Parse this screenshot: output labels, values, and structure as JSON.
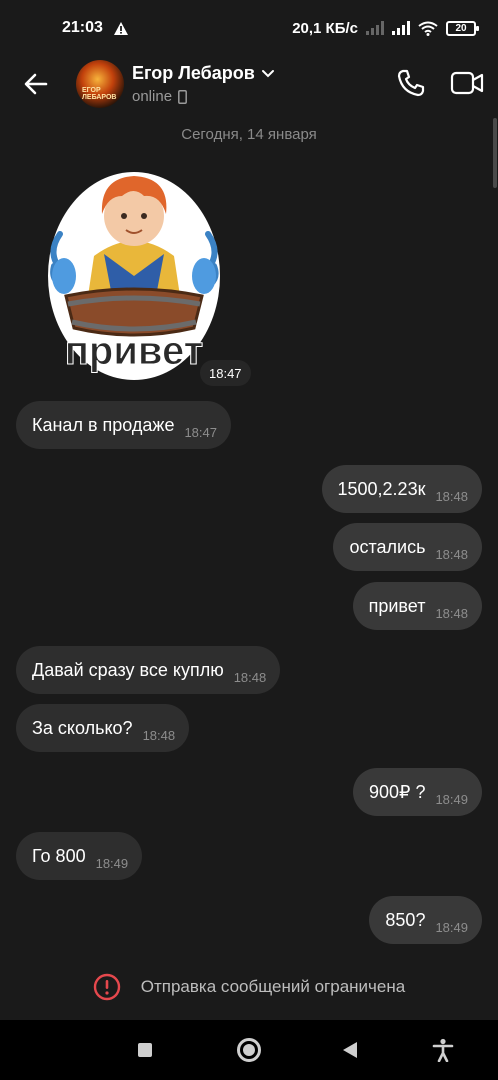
{
  "status_bar": {
    "time": "21:03",
    "network_speed": "20,1 КБ/с",
    "battery": "20",
    "icons": [
      "alert-icon",
      "signal-icon",
      "wifi-icon",
      "battery-icon"
    ]
  },
  "header": {
    "contact_name": "Егор Лебаров",
    "presence": "online",
    "avatar_text": "ЕГОР ЛЕБАРОВ",
    "icons": [
      "back-arrow-icon",
      "chevron-down-icon",
      "phone-icon",
      "video-call-icon"
    ]
  },
  "chat": {
    "date_separator": "Сегодня, 14 января",
    "sticker": {
      "caption": "привет",
      "time": "18:47"
    },
    "messages": [
      {
        "direction": "in",
        "text": "Канал в продаже",
        "time": "18:47"
      },
      {
        "direction": "out",
        "text": "1500,2.23к",
        "time": "18:48"
      },
      {
        "direction": "out",
        "text": "остались",
        "time": "18:48"
      },
      {
        "direction": "out",
        "text": "привет",
        "time": "18:48"
      },
      {
        "direction": "in",
        "text": "Давай сразу все куплю",
        "time": "18:48"
      },
      {
        "direction": "in",
        "text": "За сколько?",
        "time": "18:48"
      },
      {
        "direction": "out",
        "text": "900₽ ?",
        "time": "18:49"
      },
      {
        "direction": "in",
        "text": "Го 800",
        "time": "18:49"
      },
      {
        "direction": "out",
        "text": "850?",
        "time": "18:49"
      }
    ]
  },
  "footer": {
    "restriction_text": "Отправка сообщений ограничена",
    "accent_color": "#e5484d"
  },
  "nav_bar": {
    "icons": [
      "recents-square-icon",
      "home-circle-icon",
      "back-triangle-icon",
      "accessibility-icon"
    ]
  }
}
